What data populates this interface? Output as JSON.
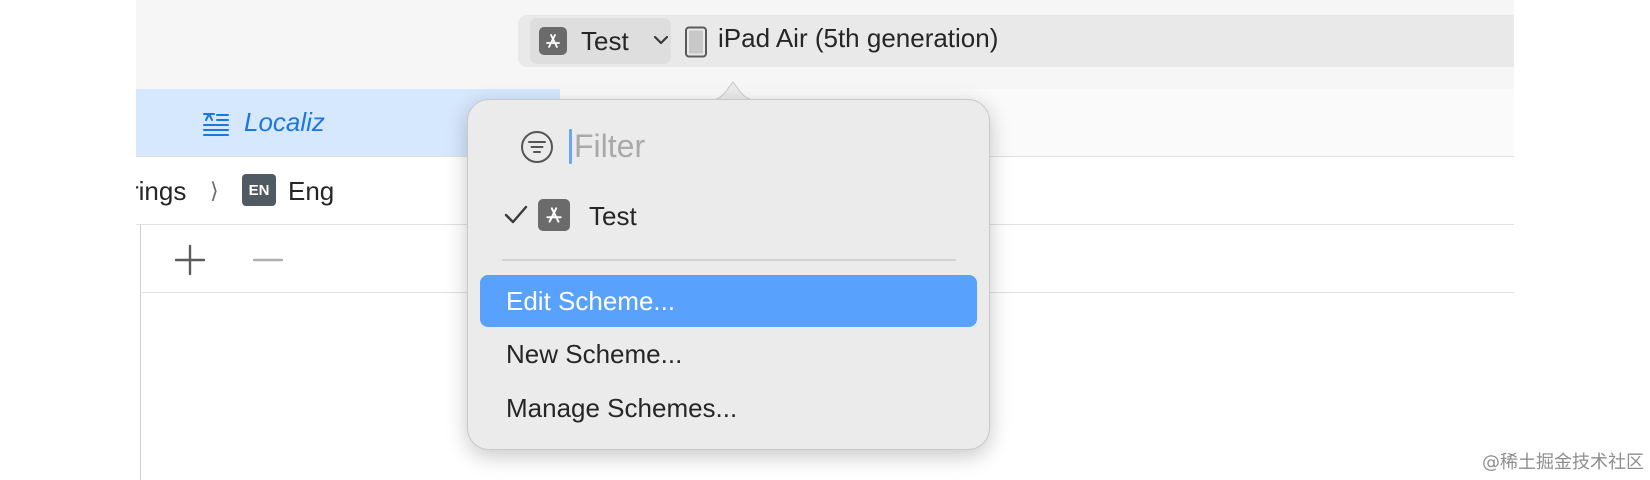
{
  "toolbar": {
    "scheme_name": "Test",
    "device_name": "iPad Air (5th generation)",
    "scheme_icon": "app-store-icon",
    "device_icon": "ipad-icon"
  },
  "tabbar": {
    "active_tab_label": "Localiz",
    "active_tab_icon": "string-catalog-icon"
  },
  "breadcrumb": {
    "parent": "rings",
    "badge": "EN",
    "current": "Eng"
  },
  "editor": {
    "add_icon": "plus-icon",
    "remove_icon": "minus-icon"
  },
  "popover": {
    "filter_placeholder": "Filter",
    "selected_scheme": "Test",
    "items": [
      {
        "label": "Edit Scheme..."
      },
      {
        "label": "New Scheme..."
      },
      {
        "label": "Manage Schemes..."
      }
    ],
    "highlight_color": "#58a1fc"
  },
  "watermark": "@稀土掘金技术社区"
}
